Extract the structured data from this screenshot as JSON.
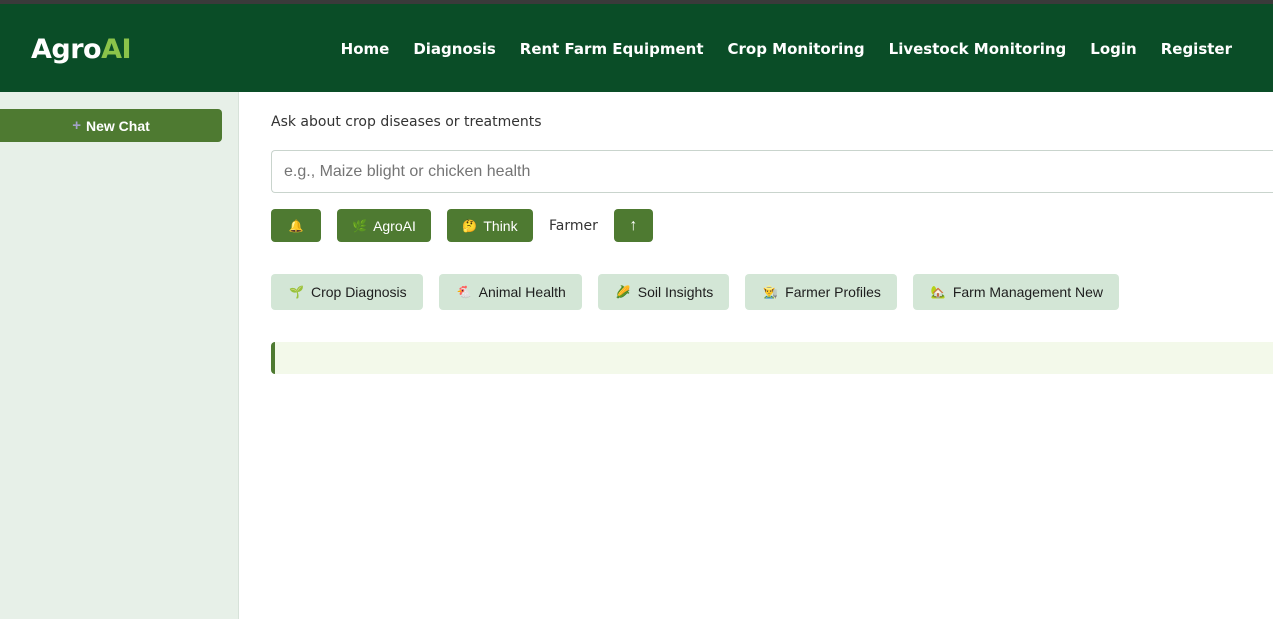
{
  "navbar": {
    "brand_primary": "Agro",
    "brand_accent": "AI",
    "links": [
      "Home",
      "Diagnosis",
      "Rent Farm Equipment",
      "Crop Monitoring",
      "Livestock Monitoring",
      "Login",
      "Register"
    ]
  },
  "sidebar": {
    "new_chat_icon": "+",
    "new_chat_label": "New Chat"
  },
  "main": {
    "prompt_label": "Ask about crop diseases or treatments",
    "search_placeholder": "e.g., Maize blight or chicken health",
    "search_value": "",
    "toolbar": {
      "bell_icon": "🔔",
      "agroai_icon": "🌿",
      "agroai_label": "AgroAI",
      "think_icon": "🤔",
      "think_label": "Think",
      "farmer_label": "Farmer",
      "send_icon": "↑"
    },
    "chips": [
      {
        "icon": "🌱",
        "label": "Crop Diagnosis"
      },
      {
        "icon": "🐔",
        "label": "Animal Health"
      },
      {
        "icon": "🌽",
        "label": "Soil Insights"
      },
      {
        "icon": "👨‍🌾",
        "label": "Farmer Profiles"
      },
      {
        "icon": "🏡",
        "label": "Farm Management New"
      }
    ]
  },
  "colors": {
    "navbar_bg": "#0a4d27",
    "brand_accent": "#8bc34a",
    "button_green": "#4e7a31",
    "sidebar_bg": "#e7f0e8",
    "chip_bg": "#d3e6d6",
    "response_bg": "#f3f9ea"
  }
}
